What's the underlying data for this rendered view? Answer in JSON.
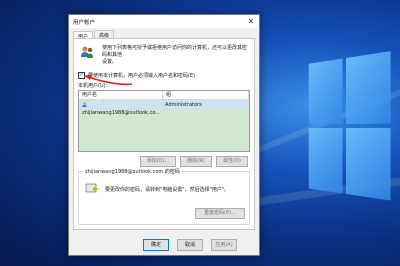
{
  "dialog": {
    "title": "用户帐户",
    "tabs": [
      {
        "label": "用户",
        "active": true
      },
      {
        "label": "高级",
        "active": false
      }
    ],
    "info_text_line1": "使用下列表格可授予或拒绝用户访问你的计算机，还可以更改其密码和其他",
    "info_text_line2": "设置。",
    "checkbox": {
      "label": "要使用本计算机，用户必须输入用户名和密码(E)",
      "checked": true
    },
    "list_label": "本机用户(U):",
    "columns": [
      "用户名",
      "组"
    ],
    "rows": [
      {
        "user": "zhijianwang1988@outlook.co...",
        "group": "Administrators"
      }
    ],
    "list_buttons": [
      "添加(D)...",
      "删除(R)",
      "属性(O)"
    ],
    "password_group": {
      "title": "zhijianwang1988@outlook.com 的密码",
      "text": "要更改你的密码，请转到\"电脑设置\"，然后选择\"用户\"。",
      "reset_button": "重置密码(P)..."
    },
    "dialog_buttons": [
      "确定",
      "取消",
      "应用(A)"
    ]
  },
  "colors": {
    "accent": "#0078d7",
    "list_bg": "#cfe8cf",
    "arrow": "#e02020"
  }
}
